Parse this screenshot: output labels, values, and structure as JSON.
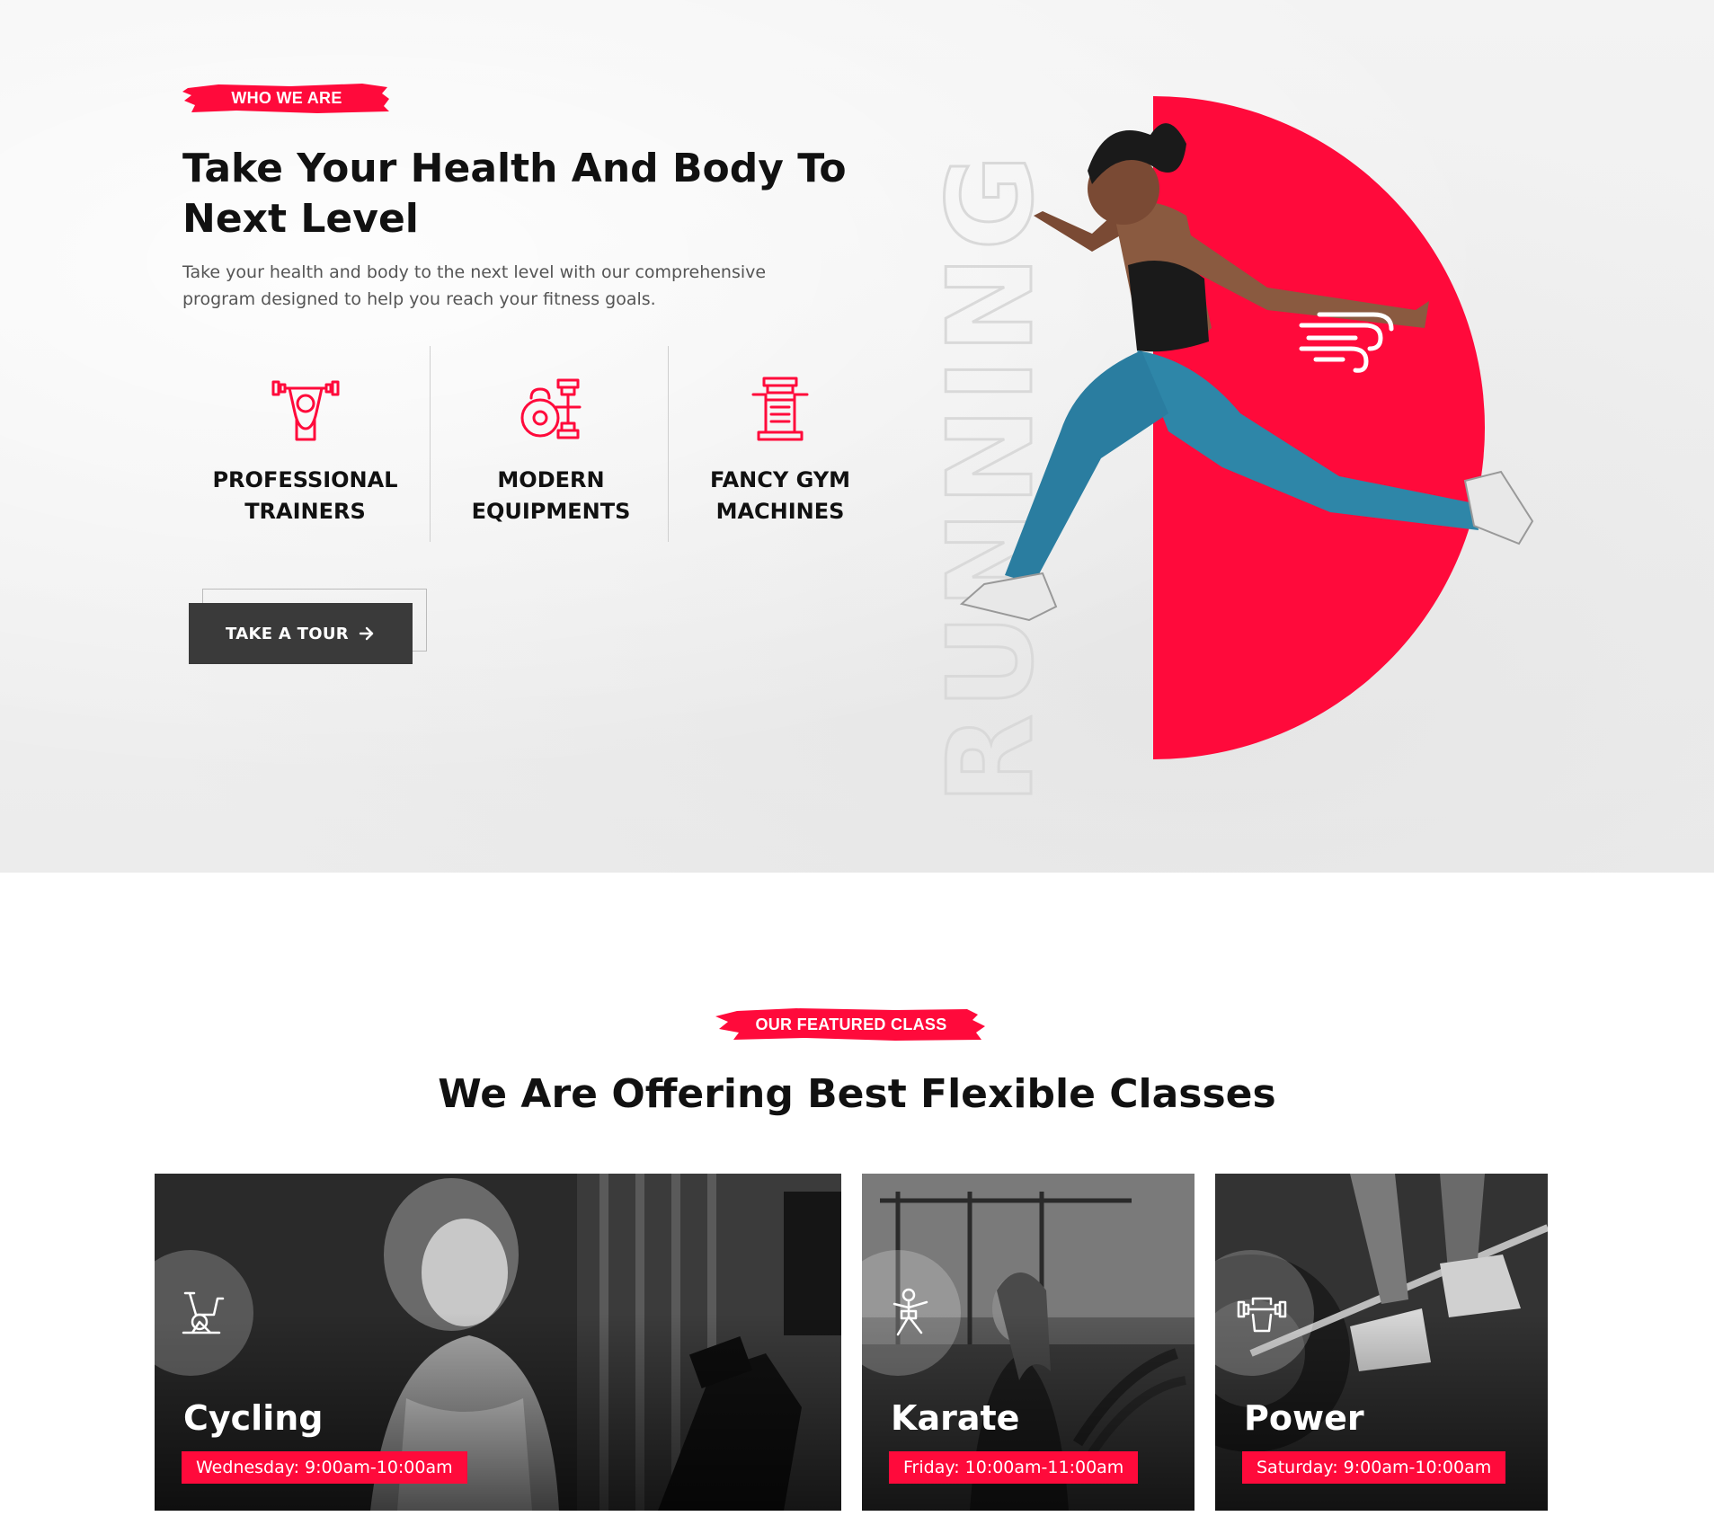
{
  "about": {
    "tag": "WHO WE ARE",
    "title": "Take Your Health And Body To Next Level",
    "description": "Take your health and body to the next level with our comprehensive program designed to help you reach your fitness goals.",
    "features": [
      {
        "label": "PROFESSIONAL TRAINERS",
        "icon": "trainer-icon"
      },
      {
        "label": "MODERN EQUIPMENTS",
        "icon": "kettlebell-dumbbell-icon"
      },
      {
        "label": "FANCY GYM MACHINES",
        "icon": "gym-machine-icon"
      }
    ],
    "button_label": "TAKE A TOUR",
    "button_icon": "arrow-right-icon",
    "side_word": "RUNNING",
    "badge_icon": "wind-icon"
  },
  "classes": {
    "tag": "OUR FEATURED CLASS",
    "title": "We Are Offering Best Flexible Classes",
    "items": [
      {
        "name": "Cycling",
        "time": "Wednesday: 9:00am-10:00am",
        "icon": "exercise-bike-icon"
      },
      {
        "name": "Karate",
        "time": "Friday: 10:00am-11:00am",
        "icon": "karate-icon"
      },
      {
        "name": "Power",
        "time": "Saturday: 9:00am-10:00am",
        "icon": "dumbbell-fist-icon"
      }
    ]
  },
  "colors": {
    "accent": "#ff0a3b",
    "dark_button": "#3a3a3a",
    "heading": "#111111",
    "body_text": "#555555"
  }
}
